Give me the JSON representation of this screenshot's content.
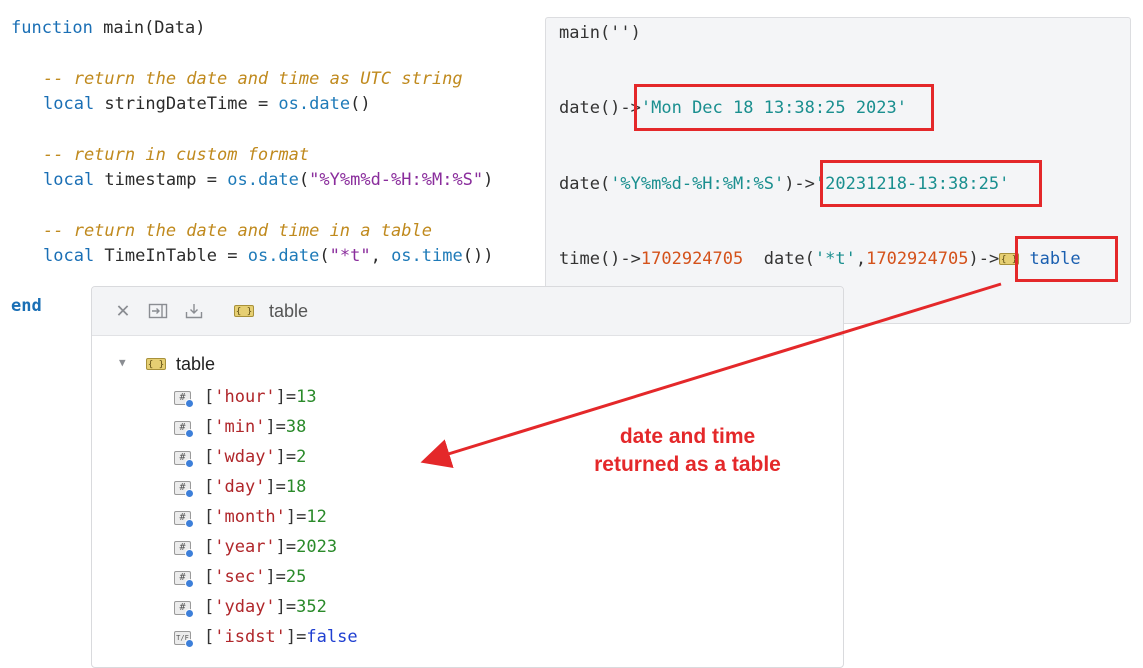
{
  "editor": {
    "line1": {
      "kw": "function",
      "rest": " main(Data)"
    },
    "line2": "-- return the date and time as UTC string",
    "line3": {
      "kw": "local",
      "var": " stringDateTime = ",
      "fn": "os.date",
      "rest": "()"
    },
    "line4": "-- return in custom format",
    "line5": {
      "kw": "local",
      "var": " timestamp = ",
      "fn": "os.date",
      "open": "(",
      "str": "\"%Y%m%d-%H:%M:%S\"",
      "close": ")"
    },
    "line6": "-- return the date and time in a table",
    "line7": {
      "kw": "local",
      "var": " TimeInTable = ",
      "fn": "os.date",
      "open": "(",
      "str": "\"*t\"",
      "sep": ", ",
      "fn2": "os.time",
      "close": "())"
    },
    "line8": {
      "kw": "end"
    }
  },
  "output": {
    "call": "main('')",
    "date_plain": {
      "prefix": "date()->",
      "value": "'Mon Dec 18 13:38:25 2023'"
    },
    "date_fmt": {
      "prefix": "date(",
      "arg": "'%Y%m%d-%H:%M:%S'",
      "mid": ")->",
      "value": "'20231218-13:38:25'"
    },
    "time_line": {
      "prefix": "time()->",
      "time_value": "1702924705",
      "date_prefix": "  date(",
      "date_arg": "'*t'",
      "comma": ",",
      "date_num": "1702924705",
      "date_suffix": ")->",
      "table_label": "table"
    }
  },
  "inspector": {
    "toolbar": {
      "close_icon": "close-icon",
      "expand_icon": "expand-icon",
      "download_icon": "download-icon",
      "title": "table"
    },
    "root_label": "table",
    "rows": [
      {
        "key": "'hour'",
        "value": "13",
        "type": "#"
      },
      {
        "key": "'min'",
        "value": "38",
        "type": "#"
      },
      {
        "key": "'wday'",
        "value": "2",
        "type": "#"
      },
      {
        "key": "'day'",
        "value": "18",
        "type": "#"
      },
      {
        "key": "'month'",
        "value": "12",
        "type": "#"
      },
      {
        "key": "'year'",
        "value": "2023",
        "type": "#"
      },
      {
        "key": "'sec'",
        "value": "25",
        "type": "#"
      },
      {
        "key": "'yday'",
        "value": "352",
        "type": "#"
      },
      {
        "key": "'isdst'",
        "value": "false",
        "type": "T/F"
      }
    ]
  },
  "annotation": {
    "line1": "date and time",
    "line2": "returned as a table",
    "color": "#e4282a"
  }
}
